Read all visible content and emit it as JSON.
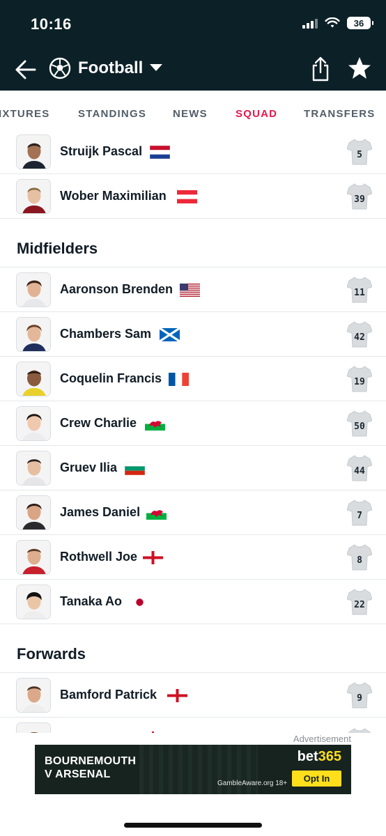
{
  "status_bar": {
    "time": "10:16",
    "battery": "36"
  },
  "header": {
    "title": "Football"
  },
  "tabs": [
    {
      "label": "IXTURES"
    },
    {
      "label": "STANDINGS"
    },
    {
      "label": "NEWS"
    },
    {
      "label": "SQUAD",
      "active": true
    },
    {
      "label": "TRANSFERS"
    }
  ],
  "squad": {
    "defenders_tail": [
      {
        "name": "Struijk Pascal",
        "number": "5",
        "flag": "netherlands"
      },
      {
        "name": "Wober Maximilian",
        "number": "39",
        "flag": "austria"
      }
    ],
    "midfielders_title": "Midfielders",
    "midfielders": [
      {
        "name": "Aaronson Brenden",
        "number": "11",
        "flag": "usa"
      },
      {
        "name": "Chambers Sam",
        "number": "42",
        "flag": "scotland"
      },
      {
        "name": "Coquelin Francis",
        "number": "19",
        "flag": "france"
      },
      {
        "name": "Crew Charlie",
        "number": "50",
        "flag": "wales"
      },
      {
        "name": "Gruev Ilia",
        "number": "44",
        "flag": "bulgaria"
      },
      {
        "name": "James Daniel",
        "number": "7",
        "flag": "wales"
      },
      {
        "name": "Rothwell Joe",
        "number": "8",
        "flag": "england"
      },
      {
        "name": "Tanaka Ao",
        "number": "22",
        "flag": "japan"
      }
    ],
    "forwards_title": "Forwards",
    "forwards": [
      {
        "name": "Bamford Patrick",
        "number": "9",
        "flag": "england"
      }
    ]
  },
  "ad": {
    "label": "Advertisement",
    "line1": "BOURNEMOUTH",
    "line2": "V ARSENAL",
    "brand_a": "bet",
    "brand_b": "365",
    "disclaimer": "GambleAware.org  18+",
    "cta": "Opt In"
  },
  "colors": {
    "header_bg": "#0c2127",
    "accent": "#e6194b"
  }
}
